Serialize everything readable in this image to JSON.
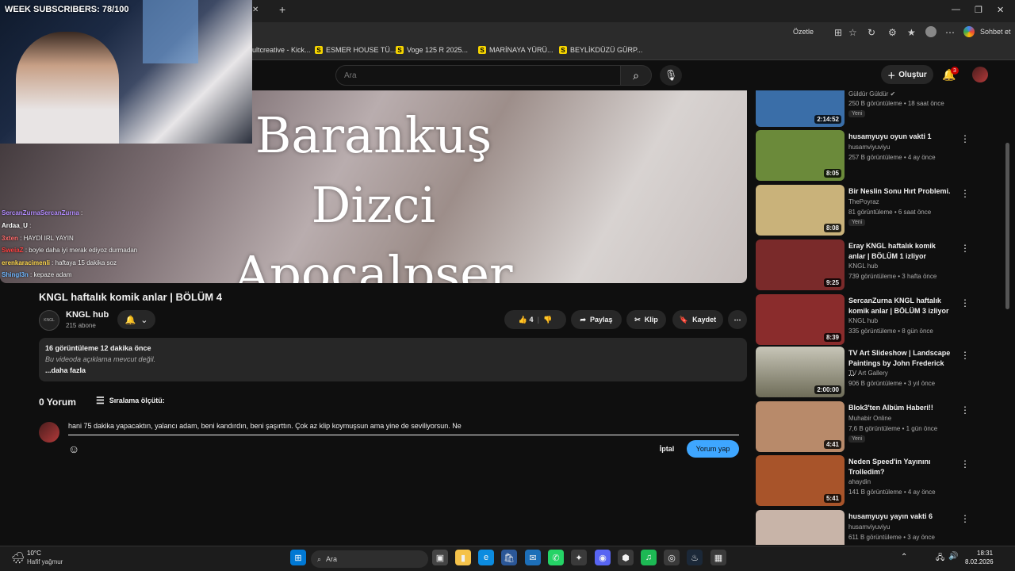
{
  "browser": {
    "tab_close": "✕",
    "new_tab": "+",
    "summarize": "Özetle",
    "chat_label": "Sohbet et",
    "bookmarks": [
      {
        "label": "ultcreative - Kick..."
      },
      {
        "label": "ESMER HOUSE TÜ...",
        "badge": "S"
      },
      {
        "label": "Voge 125 R 2025...",
        "badge": "S"
      },
      {
        "label": "MARİNAYA YÜRÜ...",
        "badge": "S"
      },
      {
        "label": "BEYLİKDÜZÜ GÜRP...",
        "badge": "S"
      }
    ]
  },
  "stream": {
    "subscribers": "WEEK SUBSCRIBERS: 78/100",
    "chat": [
      {
        "user": "SercanZurnaSercanZurna",
        "msg": ":",
        "color": "#b38cff"
      },
      {
        "user": "Ardaa_U",
        "msg": ":",
        "color": "#ffffff"
      },
      {
        "user": "3xten",
        "msg": ": HAYDİ IRL YAYIN",
        "color": "#ff6b6b"
      },
      {
        "user": "SweiaZ",
        "msg": ": boyle daha iyi merak ediyoz durmadan",
        "color": "#ff4040"
      },
      {
        "user": "erenkaracimenli",
        "msg": ": haftaya 15 dakika soz",
        "color": "#ffd84d"
      },
      {
        "user": "Shingl3n",
        "msg": ": kepaze adam",
        "color": "#6fb7ff"
      }
    ]
  },
  "youtube": {
    "search_placeholder": "Ara",
    "create_label": "Oluştur",
    "notif_count": "3",
    "video_overlay": [
      "Barankuş",
      "Dizci",
      "Apocalpser"
    ],
    "video_title": "KNGL haftalık komik anlar | BÖLÜM 4",
    "channel_name": "KNGL hub",
    "channel_subs": "215 abone",
    "likes": "4",
    "share": "Paylaş",
    "clip": "Klip",
    "save": "Kaydet",
    "desc_stats": "16 görüntüleme  12 dakika önce",
    "desc_text": "Bu videoda açıklama mevcut değil.",
    "desc_more": "...daha fazla",
    "comments_count": "0 Yorum",
    "sort_label": "Sıralama ölçütü:",
    "comment_text": "hani 75 dakika yapacaktın, yalancı adam, beni kandırdın, beni şaşırttın. Çok az klip koymuşsun ama yine de seviliyorsun. Ne",
    "cancel": "İptal",
    "post": "Yorum yap",
    "colors": {
      "accent": "#3ea6ff",
      "bg": "#0f0f0f",
      "notif": "#cc0000"
    }
  },
  "sidebar": [
    {
      "title": "",
      "channel": "Güldür Güldür",
      "meta": "250 B görüntüleme • 18 saat önce",
      "duration": "2:14:52",
      "new": "Yeni",
      "thumb": "#3a6ea8"
    },
    {
      "title": "husamyuyu oyun vakti 1",
      "channel": "husamviyuviyu",
      "meta": "257 B görüntüleme • 4 ay önce",
      "duration": "8:05",
      "new": "",
      "thumb": "#6b8a3a"
    },
    {
      "title": "Bir Neslin Sonu Hırt Problemi.",
      "channel": "ThePoyraz",
      "meta": "81 görüntüleme • 6 saat önce",
      "duration": "8:08",
      "new": "Yeni",
      "thumb": "#c9b27a"
    },
    {
      "title": "Eray KNGL haftalık komik anlar | BÖLÜM 1 izliyor",
      "channel": "KNGL hub",
      "meta": "739 görüntüleme • 3 hafta önce",
      "duration": "9:25",
      "new": "",
      "thumb": "#7a2a2a"
    },
    {
      "title": "SercanZurna KNGL haftalık komik anlar | BÖLÜM 3 izliyor",
      "channel": "KNGL hub",
      "meta": "335 görüntüleme • 8 gün önce",
      "duration": "8:39",
      "new": "",
      "thumb": "#8a2c2c"
    },
    {
      "title": "TV Art Slideshow | Landscape Paintings by John Frederick ...",
      "channel": "TV Art Gallery",
      "meta": "906 B görüntüleme • 3 yıl önce",
      "duration": "2:00:00",
      "new": "",
      "thumb": "#8a8a72"
    },
    {
      "title": "Blok3'ten Albüm Haberi!!",
      "channel": "Muhabir Online",
      "meta": "7,6 B görüntüleme • 1 gün önce",
      "duration": "4:41",
      "new": "Yeni",
      "thumb": "#b88a6a"
    },
    {
      "title": "Neden Speed'in Yayınını Trolledim?",
      "channel": "ahaydin",
      "meta": "141 B görüntüleme • 4 ay önce",
      "duration": "5:41",
      "new": "",
      "thumb": "#a8542a"
    },
    {
      "title": "husamyuyu yayın vakti 6",
      "channel": "husamviyuviyu",
      "meta": "611 B görüntüleme • 3 ay önce",
      "duration": "",
      "new": "",
      "thumb": "#c8b4a8"
    }
  ],
  "taskbar": {
    "weather_temp": "10°C",
    "weather_desc": "Hafif yağmur",
    "search": "Ara",
    "time": "18:31",
    "date": "8.02.2026"
  }
}
